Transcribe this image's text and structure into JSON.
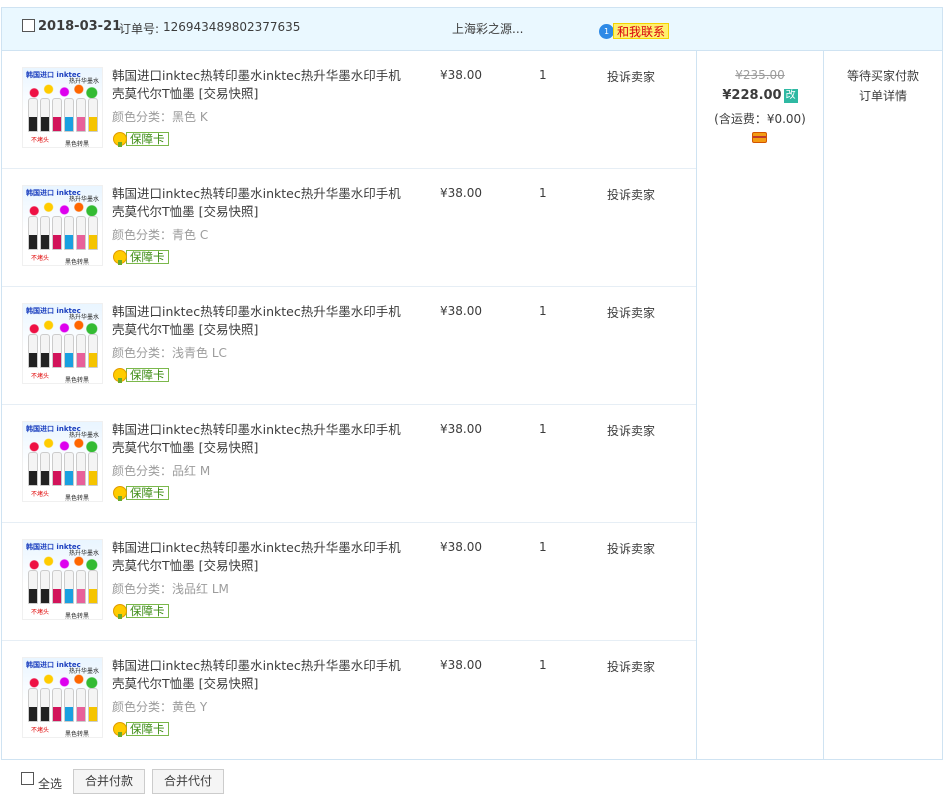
{
  "order": {
    "date": "2018-03-21",
    "order_no_label": "订单号:",
    "order_no": "126943489802377635",
    "shop": "上海彩之源...",
    "contact": "和我联系",
    "original_total": "¥235.00",
    "total": "¥228.00",
    "change_tag": "改",
    "shipping": "(含运费：¥0.00)",
    "status": "等待买家付款",
    "detail_link": "订单详情"
  },
  "thumbnail": {
    "brand": "韩国进口 inktec",
    "tag": "热升华墨水",
    "red_label": "不堵头",
    "dark_label": "黑色转黑"
  },
  "items": [
    {
      "title": "韩国进口inktec热转印墨水inktec热升华墨水印手机壳莫代尔T恤墨 [交易快照]",
      "sku": "颜色分类：黑色 K",
      "badge": "保障卡",
      "price": "¥38.00",
      "qty": "1",
      "action": "投诉卖家"
    },
    {
      "title": "韩国进口inktec热转印墨水inktec热升华墨水印手机壳莫代尔T恤墨 [交易快照]",
      "sku": "颜色分类：青色 C",
      "badge": "保障卡",
      "price": "¥38.00",
      "qty": "1",
      "action": "投诉卖家"
    },
    {
      "title": "韩国进口inktec热转印墨水inktec热升华墨水印手机壳莫代尔T恤墨 [交易快照]",
      "sku": "颜色分类：浅青色 LC",
      "badge": "保障卡",
      "price": "¥38.00",
      "qty": "1",
      "action": "投诉卖家"
    },
    {
      "title": "韩国进口inktec热转印墨水inktec热升华墨水印手机壳莫代尔T恤墨 [交易快照]",
      "sku": "颜色分类：品红 M",
      "badge": "保障卡",
      "price": "¥38.00",
      "qty": "1",
      "action": "投诉卖家"
    },
    {
      "title": "韩国进口inktec热转印墨水inktec热升华墨水印手机壳莫代尔T恤墨 [交易快照]",
      "sku": "颜色分类：浅品红 LM",
      "badge": "保障卡",
      "price": "¥38.00",
      "qty": "1",
      "action": "投诉卖家"
    },
    {
      "title": "韩国进口inktec热转印墨水inktec热升华墨水印手机壳莫代尔T恤墨 [交易快照]",
      "sku": "颜色分类：黄色 Y",
      "badge": "保障卡",
      "price": "¥38.00",
      "qty": "1",
      "action": "投诉卖家"
    }
  ],
  "footer": {
    "select_all": "全选",
    "merge_pay": "合并付款",
    "merge_proxy_pay": "合并代付"
  },
  "colors": {
    "header_bg": "#eaf8ff",
    "border": "#cfe3f2",
    "change_tag": "#2fb9a3",
    "contact_bg": "#fff06e",
    "badge_green": "#3b8b12"
  }
}
